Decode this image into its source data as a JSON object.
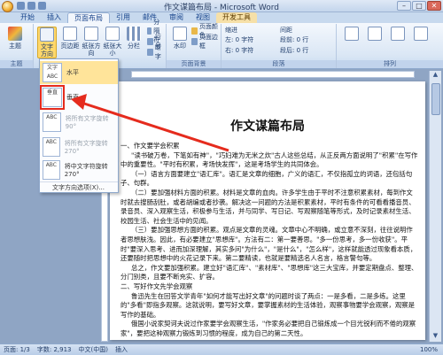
{
  "window": {
    "title": "作文谋篇布局 - Microsoft Word"
  },
  "window_controls": {
    "min": "–",
    "max": "□",
    "close": "✕"
  },
  "tabs": [
    {
      "label": "开始",
      "active": false
    },
    {
      "label": "插入",
      "active": false
    },
    {
      "label": "页面布局",
      "active": true
    },
    {
      "label": "引用",
      "active": false
    },
    {
      "label": "邮件",
      "active": false
    },
    {
      "label": "审阅",
      "active": false
    },
    {
      "label": "视图",
      "active": false
    },
    {
      "label": "开发工具",
      "active": false
    }
  ],
  "ribbon": {
    "theme_btn": "主题",
    "text_direction_btn": "文字方向",
    "margins_btn": "页边距",
    "orientation_btn": "纸张方向",
    "size_btn": "纸张大小",
    "columns_btn": "分栏",
    "breaks": "分隔符",
    "line_numbers": "行号",
    "hyphenation": "断字",
    "watermark_btn": "水印",
    "page_color": "页面颜色",
    "page_border": "页面边框",
    "group_page_bg": "页面背景",
    "indent_label": "缩进",
    "spacing_label": "间距",
    "indent_left": "左: 0 字符",
    "indent_right": "右: 0 字符",
    "spacing_before": "段前: 0 行",
    "spacing_after": "段后: 0 行",
    "group_paragraph": "段落",
    "group_arrange": "排列",
    "group_theme": "主题"
  },
  "text_direction_menu": {
    "items": [
      {
        "thumb": "文字 ABC",
        "label": "水平",
        "state": "hover"
      },
      {
        "thumb": "垂直",
        "label": "垂直",
        "state": "normal"
      },
      {
        "thumb": "ABC",
        "label": "将所有文字旋转 90°",
        "state": "disabled"
      },
      {
        "thumb": "ABC",
        "label": "将所有文字旋转 270°",
        "state": "disabled"
      },
      {
        "thumb": "ABC",
        "label": "将中文字符旋转 270°",
        "state": "normal"
      }
    ],
    "footer": "文字方向选项(X)..."
  },
  "document": {
    "title": "作文谋篇布局",
    "paragraphs": [
      "一、作文要学会积累",
      "\"读书破万卷，下笔如有神\"，\"巧妇难为无米之炊\"古人这些总结，从正反两方面说明了\"积累\"在写作中的重要性。\"平时有积累，考场快发挥\"，这是考场学生的共同体会。",
      "（一）语言方面要建立\"语汇库\"。语汇是文章的细胞，广义的语汇，不仅指孤立的词语，还包括句子、句群。",
      "（二）要加强材料方面的积累。材料是文章的血肉。许多学生由于平时不注意积累素材，每到作文时就去搜肠刮肚，或者胡编或者抄袭。解决这一问题的方法是积累素材，平时有条件的可看看播音员、录音员、深入观察生活，积极参与生活，并与同学、写日记、写观察随笔等形式，及时记录素材生活、校园生活、社会生活中的见闻。",
      "（三）要加强思想方面的积累。观点是文章的灵魂。文章中心不明确，或立意不深刻，往往说明作者思想肤浅。因此，有必要建立\"思想库\"。方法有二：第一要善思。\"多一份思考，多一份收获\"。平时\"要深入思考、进而加深理解，其实多问\"为什么\"，\"是什么\"，\"怎么样\"，这样就能透过现象看本质，还要随时把思想中的火花记录下来。第二要精读，也就是要精选名人名言，格言警句等。",
      "总之，作文要加强积累。建立好\"语汇库\"、\"素材库\"、\"思想库\"这三大宝库，并要定期盘点、整理、分门别类，且要不断充实、扩容。",
      "二、写好作文先学会观察",
      "鲁迅先生在回答文学青年\"如何才能写出好文章\"的问题时谈了两点：一是多看，二是多练。这里的\"多看\"即指多观察。这就说明，要写好文章，要掌握素材的生活体验，观察事物要学会观察，观察是写作的基础。",
      "俄国小说家契诃夫说过作家要学会观察生活，\"作家务必要把自己锻炼成一个目光锐利而不倦的观察家\"，要把这种观察力锻炼到习惯的程度，成为自己的第二天性。"
    ]
  },
  "statusbar": {
    "page": "页面: 1/3",
    "words": "字数: 2,913",
    "lang": "中文(中国)",
    "mode": "插入",
    "zoom": "100%"
  }
}
